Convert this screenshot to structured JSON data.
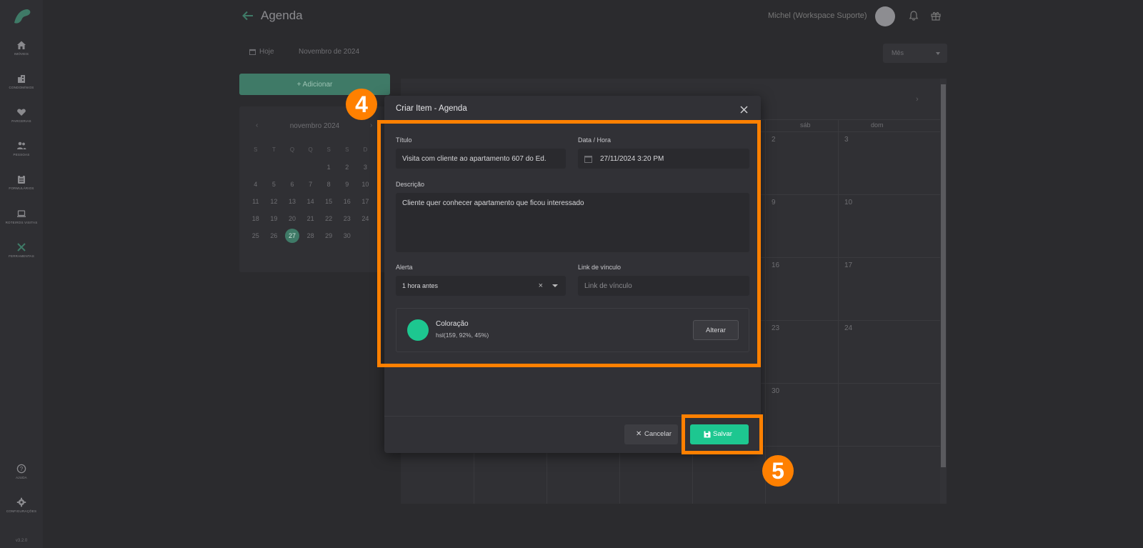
{
  "colors": {
    "accent": "#1dc790",
    "annotation": "#ff8000",
    "event_color": "#1dc790"
  },
  "sidebar": {
    "items": [
      {
        "label": "Imóveis",
        "icon": "home-icon"
      },
      {
        "label": "Condomínios",
        "icon": "building-icon"
      },
      {
        "label": "Parcerias",
        "icon": "handshake-icon"
      },
      {
        "label": "Pessoas",
        "icon": "people-icon"
      },
      {
        "label": "Formulários",
        "icon": "form-icon"
      },
      {
        "label": "Roteiros Visitas",
        "icon": "laptop-icon"
      },
      {
        "label": "Ferramentas",
        "icon": "tools-icon"
      },
      {
        "label": "Ajuda",
        "icon": "help-icon"
      },
      {
        "label": "Configurações",
        "icon": "gear-icon"
      }
    ],
    "version": "v3.2.0"
  },
  "header": {
    "title": "Agenda",
    "user_name": "Michel (Workspace Suporte)"
  },
  "toolbar": {
    "today_label": "Hoje",
    "month_label": "Novembro de 2024",
    "view_select": "Mês"
  },
  "add_button": {
    "label": "+ Adicionar"
  },
  "mini_calendar": {
    "month": "novembro 2024",
    "weekday_headers": [
      "S",
      "T",
      "Q",
      "Q",
      "S",
      "S",
      "D"
    ],
    "days": [
      "",
      "",
      "",
      "",
      "1",
      "2",
      "3",
      "4",
      "5",
      "6",
      "7",
      "8",
      "9",
      "10",
      "11",
      "12",
      "13",
      "14",
      "15",
      "16",
      "17",
      "18",
      "19",
      "20",
      "21",
      "22",
      "23",
      "24",
      "25",
      "26",
      "27",
      "28",
      "29",
      "30",
      ""
    ],
    "today": "27"
  },
  "big_calendar": {
    "weekday_headers": [
      "sáb",
      "dom"
    ],
    "day_numbers": [
      "2",
      "3",
      "9",
      "10",
      "16",
      "17",
      "23",
      "24",
      "30"
    ]
  },
  "modal": {
    "title": "Criar Item - Agenda",
    "title_label": "Título",
    "title_value": "Visita com cliente ao apartamento 607 do Ed.",
    "datetime_label": "Data / Hora",
    "datetime_value": "27/11/2024 3:20 PM",
    "description_label": "Descrição",
    "description_value": "Cliente quer conhecer apartamento que ficou interessado",
    "alert_label": "Alerta",
    "alert_value": "1 hora antes",
    "link_label": "Link de vínculo",
    "link_placeholder": "Link de vínculo",
    "color_label": "Coloração",
    "color_value": "hsl(159, 92%, 45%)",
    "change_button": "Alterar",
    "cancel_button": "Cancelar",
    "save_button": "Salvar"
  },
  "annotations": {
    "step_a": "4",
    "step_b": "5"
  }
}
